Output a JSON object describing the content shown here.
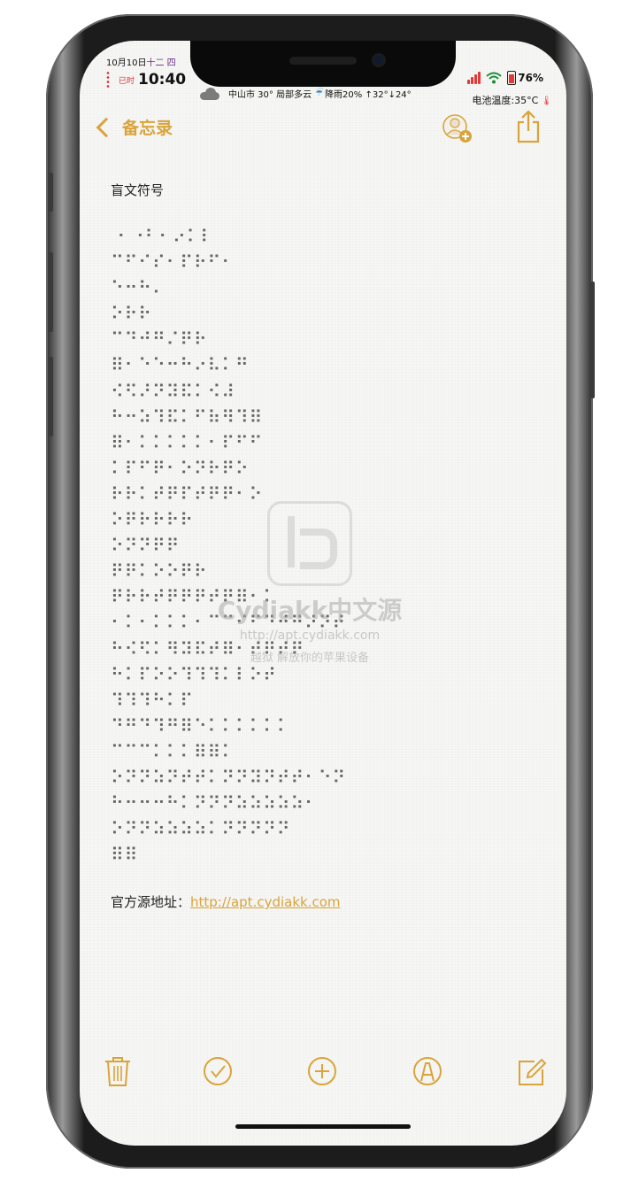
{
  "status_bar": {
    "date": "10月10日",
    "lunar": "十二",
    "weekday": "四",
    "lock_label": "已时",
    "time": "10:40",
    "weather_text": "中山市 30° 局部多云",
    "rain_text": "降雨20% ↑32°↓24°",
    "battery": "76%",
    "battery_temp": "电池温度:35°C"
  },
  "nav": {
    "back_label": "备忘录"
  },
  "note": {
    "title": "盲文符号",
    "braille_lines": [
      " ⠂⠐⠃⠂⠔⠅⠇",
      "⠉⠋⠊⠎⠂⠏⠗⠋⠂",
      "⠑⠒⠓⠄",
      "⠕⠗⠗",
      "⠉⠙⠚⠛⠌⠟⠗",
      "⠿⠂⠑⠑⠒⠓⠔⠧⠅⠛",
      "⠪⠫⠜⠝⠽⠯⠅⠪⠼",
      "⠓⠒⠵⠹⠯⠅⠋⠷⠻⠹⠿",
      "⠿⠂⠅⠅⠅⠅⠅⠂⠏⠋⠋",
      "⠅⠏⠋⠟⠂⠕⠝⠗⠟⠕",
      "⠗⠗⠅⠞⠟⠏⠞⠟⠟⠂⠕",
      "⠕⠟⠗⠗⠗⠗",
      "⠕⠝⠝⠟⠟",
      "⠟⠟⠅⠕⠕⠟⠗",
      "⠟⠗⠗⠞⠟⠟⠟⠞⠟⠿⠂⠅",
      "⠂⠅⠂⠅⠅⠅⠂⠉⠉⠊⠋⠙⠚⠛⠜⠝⠞",
      "⠓⠪⠫⠅⠻⠽⠯⠞⠿⠂⠞⠟⠞⠟",
      "⠓⠅⠏⠕⠕⠹⠹⠹⠅⠇⠕⠞",
      "⠹⠹⠹⠓⠅⠏",
      "⠙⠛⠙⠹⠛⠿⠑⠅⠅⠅⠅⠅⠅",
      "⠉⠉⠉⠅⠅⠅⠿⠿⠅",
      "⠕⠝⠝⠵⠝⠞⠞⠅⠝⠝⠽⠝⠞⠞⠂⠑⠝",
      "⠓⠒⠒⠒⠓⠅⠝⠝⠝⠵⠵⠵⠵⠵⠂",
      "⠕⠝⠝⠵⠵⠵⠵⠅⠝⠝⠝⠝⠝",
      "⠿⠿"
    ],
    "url_label": "官方源地址：",
    "url": "http://apt.cydiakk.com"
  },
  "watermark": {
    "title": "Cydiakk中文源",
    "url": "http://apt.cydiakk.com",
    "slogan": "越狱 解放你的苹果设备"
  },
  "toolbar": {
    "items": [
      "trash-icon",
      "checklist-icon",
      "add-icon",
      "markup-icon",
      "compose-icon"
    ]
  },
  "colors": {
    "accent": "#d9a43b",
    "background": "#f6f6f4"
  }
}
